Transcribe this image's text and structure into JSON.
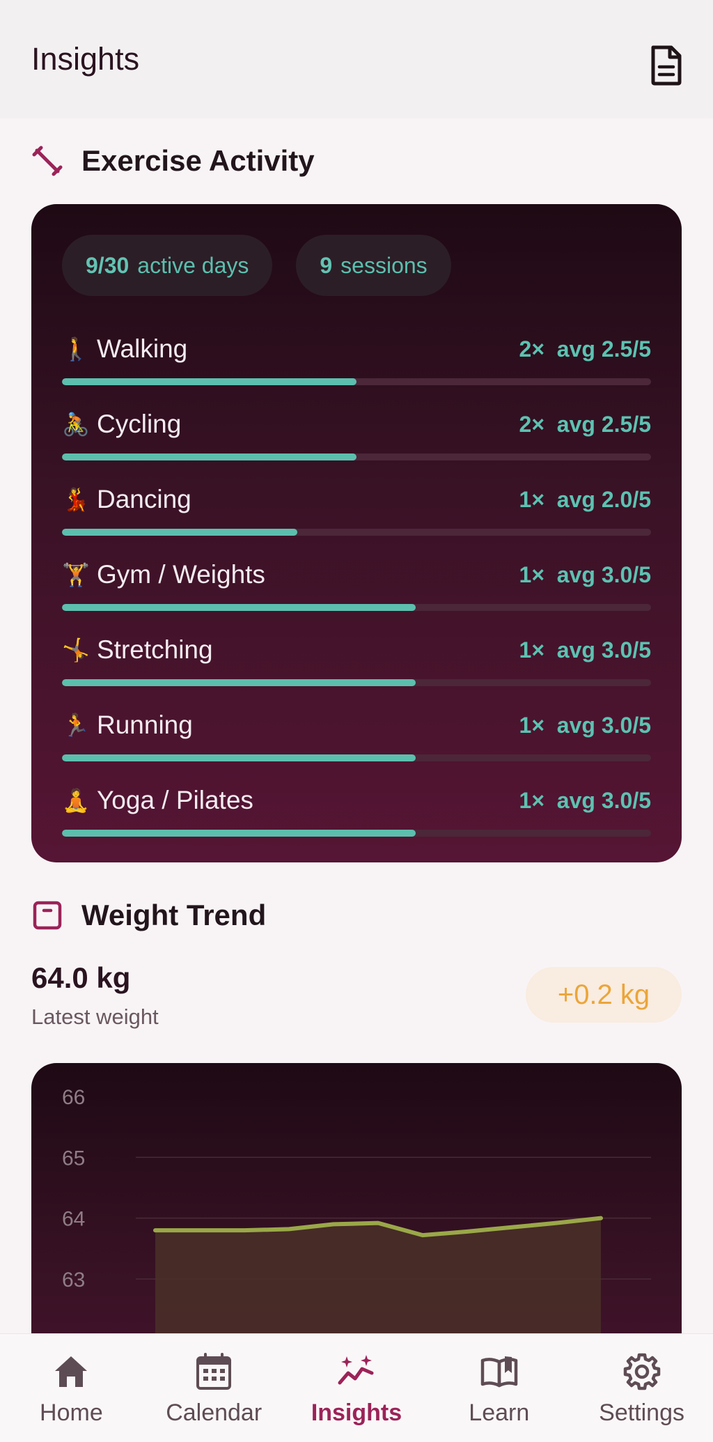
{
  "header": {
    "title": "Insights",
    "report_icon": "document-icon"
  },
  "exercise": {
    "title": "Exercise Activity",
    "icon": "dumbbell-icon",
    "chips": [
      {
        "value": "9/30",
        "label": "active days"
      },
      {
        "value": "9",
        "label": "sessions"
      }
    ],
    "activities": [
      {
        "emoji": "🚶",
        "name": "Walking",
        "count": "2×",
        "avg": "avg 2.5/5",
        "fill": 0.5
      },
      {
        "emoji": "🚴",
        "name": "Cycling",
        "count": "2×",
        "avg": "avg 2.5/5",
        "fill": 0.5
      },
      {
        "emoji": "💃",
        "name": "Dancing",
        "count": "1×",
        "avg": "avg 2.0/5",
        "fill": 0.4
      },
      {
        "emoji": "🏋",
        "name": "Gym / Weights",
        "count": "1×",
        "avg": "avg 3.0/5",
        "fill": 0.6
      },
      {
        "emoji": "🤸",
        "name": "Stretching",
        "count": "1×",
        "avg": "avg 3.0/5",
        "fill": 0.6
      },
      {
        "emoji": "🏃",
        "name": "Running",
        "count": "1×",
        "avg": "avg 3.0/5",
        "fill": 0.6
      },
      {
        "emoji": "🧘",
        "name": "Yoga / Pilates",
        "count": "1×",
        "avg": "avg 3.0/5",
        "fill": 0.6
      }
    ]
  },
  "weight": {
    "title": "Weight Trend",
    "icon": "scale-icon",
    "latest_value": "64.0 kg",
    "latest_label": "Latest weight",
    "delta": "+0.2 kg"
  },
  "chart_data": {
    "type": "area",
    "y_ticks": [
      "66",
      "65",
      "64",
      "63"
    ],
    "ylim": [
      62.5,
      66
    ],
    "x": [
      0,
      1,
      2,
      3,
      4,
      5,
      6,
      7,
      8,
      9,
      10
    ],
    "values": [
      63.8,
      63.8,
      63.8,
      63.82,
      63.9,
      63.92,
      63.72,
      63.78,
      63.85,
      63.92,
      64.0
    ],
    "line_color": "#9aa848",
    "fill_color": "#4a3028"
  },
  "nav": {
    "items": [
      {
        "label": "Home",
        "icon": "home-icon",
        "active": false
      },
      {
        "label": "Calendar",
        "icon": "calendar-icon",
        "active": false
      },
      {
        "label": "Insights",
        "icon": "insights-icon",
        "active": true
      },
      {
        "label": "Learn",
        "icon": "book-icon",
        "active": false
      },
      {
        "label": "Settings",
        "icon": "gear-icon",
        "active": false
      }
    ]
  },
  "colors": {
    "accent": "#9b2358",
    "teal": "#5cbfae",
    "orange": "#eba53a"
  }
}
